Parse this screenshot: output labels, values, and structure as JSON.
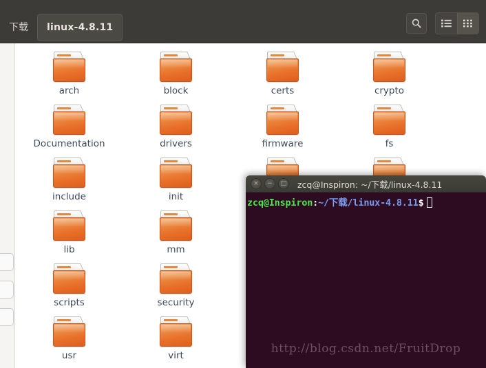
{
  "file_manager": {
    "breadcrumb": [
      {
        "label": "下载",
        "current": false
      },
      {
        "label": "linux-4.8.11",
        "current": true
      }
    ],
    "toolbar": {
      "search_icon": "search-icon",
      "list_view_icon": "list-view-icon",
      "grid_view_icon": "grid-view-icon",
      "active_view": "grid"
    },
    "colors": {
      "header_bg": "#3c3b37",
      "content_bg": "#ffffff",
      "folder_orange": "#e8702a",
      "label_text": "#3b4a5c"
    },
    "items": [
      {
        "name": "arch",
        "col": 0,
        "row": 0,
        "occluded": false
      },
      {
        "name": "block",
        "col": 1,
        "row": 0,
        "occluded": false
      },
      {
        "name": "certs",
        "col": 2,
        "row": 0,
        "occluded": false
      },
      {
        "name": "crypto",
        "col": 3,
        "row": 0,
        "occluded": false
      },
      {
        "name": "Documentation",
        "col": 0,
        "row": 1,
        "occluded": false
      },
      {
        "name": "drivers",
        "col": 1,
        "row": 1,
        "occluded": false
      },
      {
        "name": "firmware",
        "col": 2,
        "row": 1,
        "occluded": false
      },
      {
        "name": "fs",
        "col": 3,
        "row": 1,
        "occluded": false
      },
      {
        "name": "include",
        "col": 0,
        "row": 2,
        "occluded": false
      },
      {
        "name": "init",
        "col": 1,
        "row": 2,
        "occluded": false
      },
      {
        "name": "",
        "col": 2,
        "row": 2,
        "occluded": true
      },
      {
        "name": "",
        "col": 3,
        "row": 2,
        "occluded": true
      },
      {
        "name": "lib",
        "col": 0,
        "row": 3,
        "occluded": false
      },
      {
        "name": "mm",
        "col": 1,
        "row": 3,
        "occluded": false
      },
      {
        "name": "scripts",
        "col": 0,
        "row": 4,
        "occluded": false
      },
      {
        "name": "security",
        "col": 1,
        "row": 4,
        "occluded": false
      },
      {
        "name": "usr",
        "col": 0,
        "row": 5,
        "occluded": false
      },
      {
        "name": "virt",
        "col": 1,
        "row": 5,
        "occluded": false
      }
    ]
  },
  "terminal": {
    "title": "zcq@Inspiron: ~/下载/linux-4.8.11",
    "window_buttons": {
      "close": "×",
      "minimize": "−",
      "maximize": "□"
    },
    "prompt": {
      "user_host": "zcq@Inspiron",
      "colon": ":",
      "path": "~/下载/linux-4.8.11",
      "dollar": "$",
      "command": ""
    },
    "watermark": "http://blog.csdn.net/FruitDrop",
    "colors": {
      "background": "#2d0b20",
      "titlebar": "#3b3a34",
      "user_host": "#4ee24e",
      "path": "#7a9cf0",
      "watermark": "#6e4f60"
    }
  }
}
